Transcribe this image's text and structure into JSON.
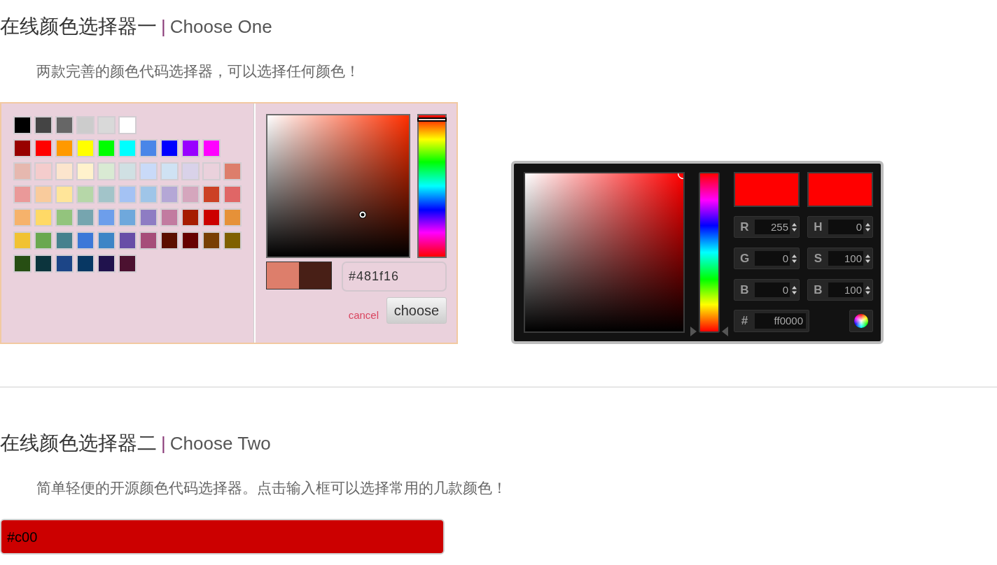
{
  "section_one": {
    "heading": {
      "title": "在线颜色选择器一",
      "separator": "|",
      "subtitle": "Choose One"
    },
    "description": "两款完善的颜色代码选择器，可以选择任何颜色！",
    "palette_picker": {
      "palette": [
        [
          {
            "color": "#000000"
          },
          {
            "color": "#444444"
          },
          {
            "color": "#666666"
          },
          {
            "color": "#cccccc"
          },
          {
            "color": "#d9d9d9"
          },
          {
            "color": "#ffffff"
          }
        ],
        [
          {
            "color": "#980000"
          },
          {
            "color": "#ff0000"
          },
          {
            "color": "#ff9900"
          },
          {
            "color": "#ffff00"
          },
          {
            "color": "#00ff00"
          },
          {
            "color": "#00ffff"
          },
          {
            "color": "#4a86e8"
          },
          {
            "color": "#0000ff"
          },
          {
            "color": "#9900ff"
          },
          {
            "color": "#ff00ff"
          }
        ],
        [
          {
            "color": "#e6b8af"
          },
          {
            "color": "#f4cccc"
          },
          {
            "color": "#fce5cd"
          },
          {
            "color": "#fff2cc"
          },
          {
            "color": "#d9ead3"
          },
          {
            "color": "#d0e0e3"
          },
          {
            "color": "#c9daf8"
          },
          {
            "color": "#cfe2f3"
          },
          {
            "color": "#d9d2e9"
          },
          {
            "color": "#ead1dc"
          },
          {
            "color": "#dd7e6b"
          }
        ],
        [
          {
            "color": "#ea9999"
          },
          {
            "color": "#f9cb9c"
          },
          {
            "color": "#ffe599"
          },
          {
            "color": "#b6d7a8"
          },
          {
            "color": "#a2c4c9"
          },
          {
            "color": "#a4c2f4"
          },
          {
            "color": "#9fc5e8"
          },
          {
            "color": "#b4a7d6"
          },
          {
            "color": "#d5a6bd"
          },
          {
            "color": "#cc4125"
          },
          {
            "color": "#e06666"
          }
        ],
        [
          {
            "color": "#f6b26b"
          },
          {
            "color": "#ffd966"
          },
          {
            "color": "#93c47d"
          },
          {
            "color": "#76a5af"
          },
          {
            "color": "#6d9eeb"
          },
          {
            "color": "#6fa8dc"
          },
          {
            "color": "#8e7cc3"
          },
          {
            "color": "#c27ba0"
          },
          {
            "color": "#a61c00"
          },
          {
            "color": "#cc0000"
          },
          {
            "color": "#e69138"
          }
        ],
        [
          {
            "color": "#f1c232"
          },
          {
            "color": "#6aa84f"
          },
          {
            "color": "#45818e"
          },
          {
            "color": "#3c78d8"
          },
          {
            "color": "#3d85c6"
          },
          {
            "color": "#674ea7"
          },
          {
            "color": "#a64d79"
          },
          {
            "color": "#5b0f00"
          },
          {
            "color": "#660000"
          },
          {
            "color": "#783f04"
          },
          {
            "color": "#7f6000"
          }
        ],
        [
          {
            "color": "#274e13"
          },
          {
            "color": "#0c343d"
          },
          {
            "color": "#1c4587"
          },
          {
            "color": "#073763"
          },
          {
            "color": "#20124d"
          },
          {
            "color": "#4c1130"
          }
        ]
      ],
      "hue_slider": {
        "level": 0.03
      },
      "previous_color": {
        "color": "#dd7e6b"
      },
      "current_color": {
        "color": "#481f16"
      },
      "hex_input": {
        "value": "#481f16"
      },
      "cancel_link": "cancel",
      "choose_button": "choose"
    },
    "dark_picker": {
      "hue_slider": {
        "level": 0
      },
      "new_color": {
        "color": "#ff0000"
      },
      "current_color": {
        "color": "#ff0000"
      },
      "fields": [
        {
          "label": "R",
          "value": "255"
        },
        {
          "label": "H",
          "value": "0"
        },
        {
          "label": "G",
          "value": "0"
        },
        {
          "label": "S",
          "value": "100"
        },
        {
          "label": "B",
          "value": "0"
        },
        {
          "label": "B",
          "value": "100"
        }
      ],
      "hex_field": {
        "label": "#",
        "value": "ff0000"
      }
    }
  },
  "section_two": {
    "heading": {
      "title": "在线颜色选择器二",
      "separator": "|",
      "subtitle": "Choose Two"
    },
    "description": "简单轻便的开源颜色代码选择器。点击输入框可以选择常用的几款颜色！",
    "color_input": {
      "value": "#c00",
      "color": "#cc0000"
    }
  }
}
